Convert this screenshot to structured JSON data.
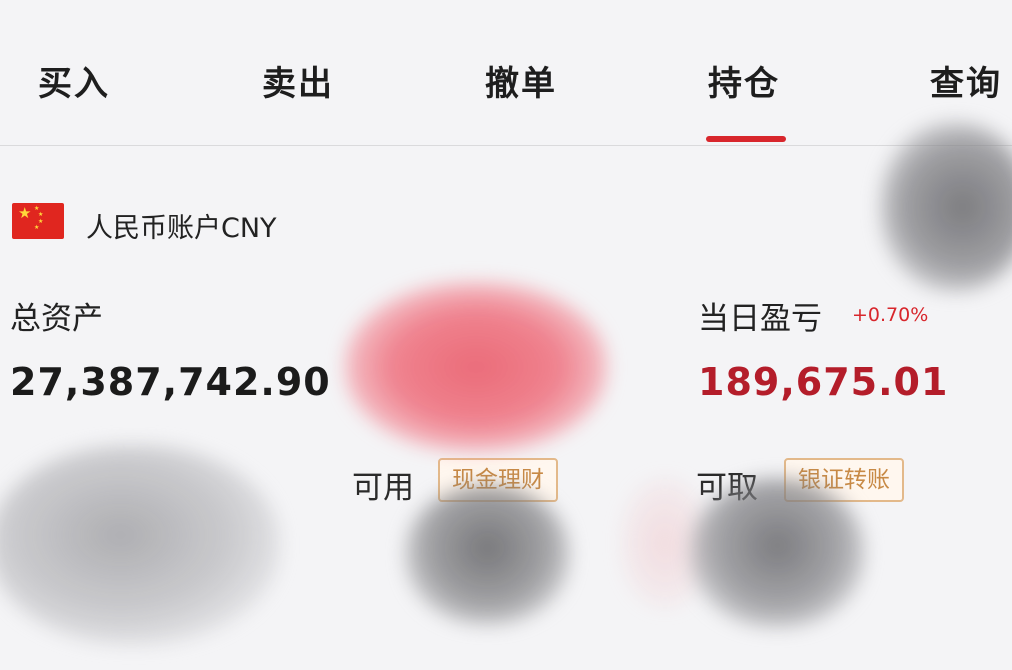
{
  "tabs": [
    {
      "label": "买入"
    },
    {
      "label": "卖出"
    },
    {
      "label": "撤单"
    },
    {
      "label": "持仓"
    },
    {
      "label": "查询"
    }
  ],
  "active_tab": "持仓",
  "account": {
    "label": "人民币账户CNY"
  },
  "summary": {
    "total_assets_label": "总资产",
    "total_assets_value": "27,387,742.90",
    "daily_pnl_label": "当日盈亏",
    "daily_pnl_percent": "+0.70%",
    "daily_pnl_value": "189,675.01",
    "available_label": "可用",
    "cash_button_label": "现金理财",
    "withdrawable_label": "可取",
    "bank_transfer_label": "银证转账"
  },
  "colors": {
    "accent_red": "#d8262c",
    "profit_red": "#b41d2a",
    "chip_border": "#e3b98a",
    "chip_text": "#c88a46"
  }
}
